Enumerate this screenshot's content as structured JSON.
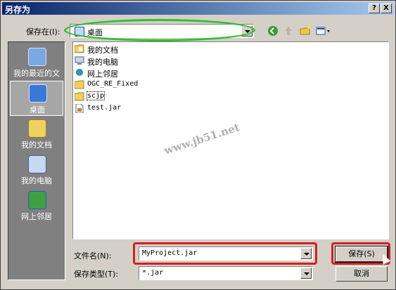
{
  "window": {
    "title": "另存为",
    "help_label": "?",
    "close_label": "X"
  },
  "toolbar": {
    "save_in_label": "保存在(I):",
    "location": "桌面"
  },
  "places": [
    {
      "label": "我的最近的文档",
      "icon": "recent-icon"
    },
    {
      "label": "桌面",
      "icon": "desktop-icon"
    },
    {
      "label": "我的文档",
      "icon": "my-documents-icon"
    },
    {
      "label": "我的电脑",
      "icon": "my-computer-icon"
    },
    {
      "label": "网上邻居",
      "icon": "network-icon"
    }
  ],
  "files": [
    {
      "name": "我的文档",
      "icon": "folder-docs-icon"
    },
    {
      "name": "我的电脑",
      "icon": "computer-icon"
    },
    {
      "name": "网上邻居",
      "icon": "network-icon"
    },
    {
      "name": "OGC_RE_Fixed",
      "icon": "folder-icon"
    },
    {
      "name": "scjp",
      "icon": "folder-icon"
    },
    {
      "name": "test.jar",
      "icon": "jar-file-icon"
    }
  ],
  "watermark": "www.jb51.net",
  "bottom": {
    "filename_label": "文件名(N):",
    "filename_value": "MyProject.jar",
    "filetype_label": "保存类型(T):",
    "filetype_value": "*.jar",
    "save_label": "保存(S)",
    "cancel_label": "取消"
  }
}
